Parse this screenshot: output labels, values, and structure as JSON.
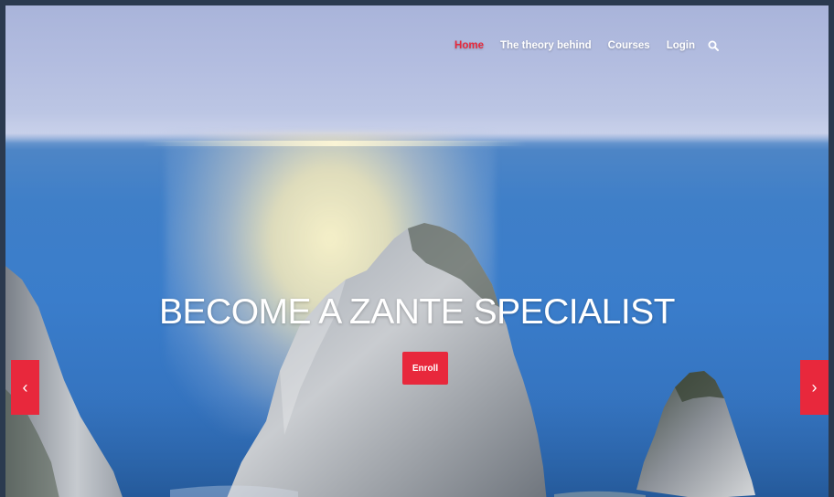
{
  "nav": {
    "items": [
      {
        "label": "Home",
        "active": true
      },
      {
        "label": "The theory behind",
        "active": false
      },
      {
        "label": "Courses",
        "active": false
      },
      {
        "label": "Login",
        "active": false
      }
    ],
    "search_icon": "search-icon"
  },
  "hero": {
    "headline": "BECOME A ZANTE SPECIALIST",
    "cta_label": "Enroll",
    "prev_arrow": "‹",
    "next_arrow": "›"
  },
  "colors": {
    "accent": "#e8283c",
    "frame": "#2b3a4f"
  }
}
